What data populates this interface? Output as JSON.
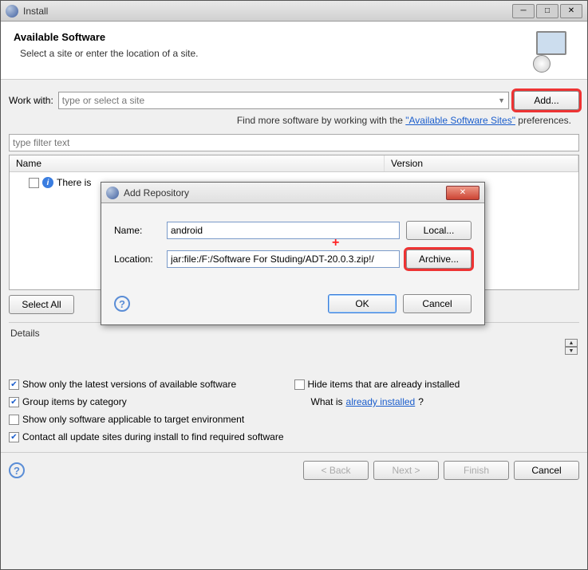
{
  "window": {
    "title": "Install"
  },
  "header": {
    "title": "Available Software",
    "subtitle": "Select a site or enter the location of a site."
  },
  "workWith": {
    "label": "Work with:",
    "placeholder": "type or select a site",
    "addBtn": "Add..."
  },
  "findMore": {
    "prefix": "Find more software by working with the ",
    "link": "\"Available Software Sites\"",
    "suffix": " preferences."
  },
  "filterPlaceholder": "type filter text",
  "table": {
    "colName": "Name",
    "colVersion": "Version",
    "row0": "There is"
  },
  "selectAll": "Select All",
  "detailsLabel": "Details",
  "options": {
    "showLatest": "Show only the latest versions of available software",
    "hideInstalled": "Hide items that are already installed",
    "groupCategory": "Group items by category",
    "whatIs": "What is ",
    "alreadyInstalledLink": "already installed",
    "q": "?",
    "targetEnv": "Show only software applicable to target environment",
    "contactAll": "Contact all update sites during install to find required software"
  },
  "footer": {
    "back": "< Back",
    "next": "Next >",
    "finish": "Finish",
    "cancel": "Cancel"
  },
  "modal": {
    "title": "Add Repository",
    "nameLabel": "Name:",
    "nameValue": "android",
    "locLabel": "Location:",
    "locValue": "jar:file:/F:/Software For Studing/ADT-20.0.3.zip!/",
    "localBtn": "Local...",
    "archiveBtn": "Archive...",
    "ok": "OK",
    "cancel": "Cancel"
  }
}
